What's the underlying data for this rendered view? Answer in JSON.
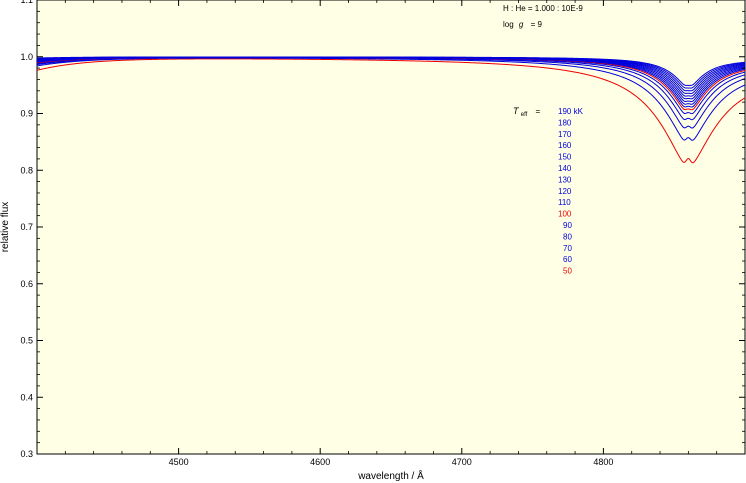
{
  "chart_data": {
    "type": "line",
    "xlabel": "wavelength / Å",
    "ylabel": "relative flux",
    "xlim": [
      4400,
      4900
    ],
    "ylim": [
      0.3,
      1.1
    ],
    "x_ticks": [
      4500,
      4600,
      4700,
      4800
    ],
    "y_ticks": [
      0.3,
      0.4,
      0.5,
      0.6,
      0.7,
      0.8,
      0.9,
      1.0,
      1.1
    ],
    "x_tick_labels": [
      "4500",
      "4600",
      "4700",
      "4800"
    ],
    "y_tick_labels": [
      "0.3",
      "0.4",
      "0.5",
      "0.6",
      "0.7",
      "0.8",
      "0.9",
      "1.0",
      "1.1"
    ],
    "grid": false,
    "line_center": 4860,
    "annotations": {
      "composition": "H : He = 1.000 : 10E-9",
      "logg_prefix": "log",
      "logg_g": "g",
      "logg_value": "= 9",
      "teff_T": "T",
      "teff_sub": "eff",
      "teff_eq": "="
    },
    "colors": {
      "plot_bg": "#ffffe6",
      "blue": "#0000dd",
      "red": "#ee0000"
    },
    "legend_position": "center-right",
    "series": [
      {
        "label": "190 kK",
        "color": "#0000dd",
        "min_flux": 0.945,
        "left_flux": 0.998,
        "right_flux": 0.99
      },
      {
        "label": "180",
        "color": "#0000dd",
        "min_flux": 0.94,
        "left_flux": 0.997,
        "right_flux": 0.989
      },
      {
        "label": "170",
        "color": "#0000dd",
        "min_flux": 0.935,
        "left_flux": 0.997,
        "right_flux": 0.988
      },
      {
        "label": "160",
        "color": "#0000dd",
        "min_flux": 0.93,
        "left_flux": 0.996,
        "right_flux": 0.987
      },
      {
        "label": "150",
        "color": "#0000dd",
        "min_flux": 0.925,
        "left_flux": 0.995,
        "right_flux": 0.986
      },
      {
        "label": "140",
        "color": "#0000dd",
        "min_flux": 0.92,
        "left_flux": 0.994,
        "right_flux": 0.985
      },
      {
        "label": "130",
        "color": "#0000dd",
        "min_flux": 0.915,
        "left_flux": 0.993,
        "right_flux": 0.984
      },
      {
        "label": "120",
        "color": "#0000dd",
        "min_flux": 0.91,
        "left_flux": 0.992,
        "right_flux": 0.983
      },
      {
        "label": "110",
        "color": "#0000dd",
        "min_flux": 0.905,
        "left_flux": 0.991,
        "right_flux": 0.982
      },
      {
        "label": "100",
        "color": "#ee0000",
        "min_flux": 0.9,
        "left_flux": 0.99,
        "right_flux": 0.98
      },
      {
        "label": "90",
        "color": "#0000dd",
        "min_flux": 0.893,
        "left_flux": 0.989,
        "right_flux": 0.978
      },
      {
        "label": "80",
        "color": "#0000dd",
        "min_flux": 0.882,
        "left_flux": 0.988,
        "right_flux": 0.975
      },
      {
        "label": "70",
        "color": "#0000dd",
        "min_flux": 0.867,
        "left_flux": 0.987,
        "right_flux": 0.972
      },
      {
        "label": "60",
        "color": "#0000dd",
        "min_flux": 0.845,
        "left_flux": 0.985,
        "right_flux": 0.966
      },
      {
        "label": "50",
        "color": "#ee0000",
        "min_flux": 0.805,
        "left_flux": 0.978,
        "right_flux": 0.958
      }
    ]
  }
}
